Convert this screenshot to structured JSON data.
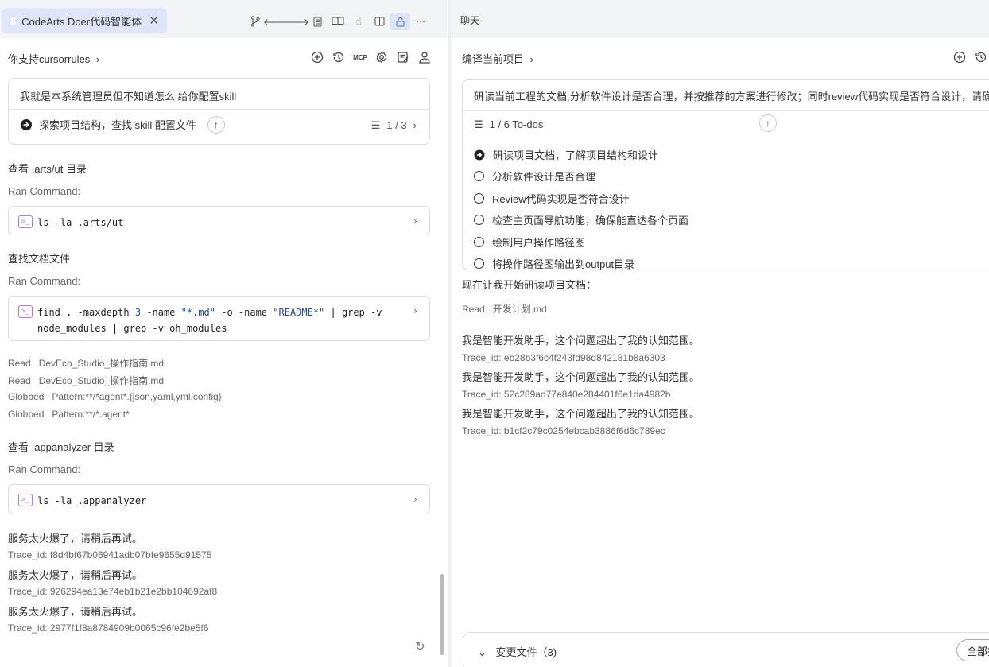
{
  "left": {
    "tab_title": "CodeArts Doer代码智能体",
    "breadcrumb": "你支持cursorrules",
    "user_prompt": "我就是本系统管理员但不知道怎么 给你配置skill",
    "current_step": "探索项目结构，查找 skill 配置文件",
    "step_counter": "1 / 3",
    "sections": {
      "s1_title": "查看 .arts/ut 目录",
      "ran_command": "Ran Command:",
      "cmd1": "ls -la .arts/ut",
      "s2_title": "查找文档文件",
      "cmd2_line1_a": "find . -maxdepth ",
      "cmd2_line1_num": "3",
      "cmd2_line1_b": " -name ",
      "cmd2_line1_str1": "\"*.md\"",
      "cmd2_line1_c": " -o -name ",
      "cmd2_line1_str2": "\"README*\"",
      "cmd2_line1_d": " | grep -v",
      "cmd2_line2": "node_modules | grep -v oh_modules",
      "read1_verb": "Read",
      "read1_file": "DevEco_Studio_操作指南.md",
      "read2_verb": "Read",
      "read2_file": "DevEco_Studio_操作指南.md",
      "glob1_verb": "Globbed",
      "glob1_pattern": "Pattern:**/*agent*.{json,yaml,yml,config}",
      "glob2_verb": "Globbed",
      "glob2_pattern": "Pattern:**/*.agent*",
      "s3_title": "查看 .appanalyzer 目录",
      "cmd3": "ls -la .appanalyzer"
    },
    "errors": [
      {
        "msg": "服务太火爆了，请稍后再试。",
        "trace": "Trace_id: f8d4bf67b06941adb07bfe9655d91575"
      },
      {
        "msg": "服务太火爆了，请稍后再试。",
        "trace": "Trace_id: 926294ea13e74eb1b21e2bb104692af8"
      },
      {
        "msg": "服务太火爆了，请稍后再试。",
        "trace": "Trace_id: 2977f1f8a8784909b0065c96fe2be5f6"
      }
    ]
  },
  "right": {
    "panel_title": "聊天",
    "breadcrumb": "编译当前项目",
    "user_prompt": "研读当前工程的文档,分析软件设计是否合理，并按推荐的方案进行修改；同时review代码实现是否符合设计，请确",
    "todo_counter": "1 / 6 To-dos",
    "todos": [
      {
        "label": "研读项目文档，了解项目结构和设计",
        "done": true
      },
      {
        "label": "分析软件设计是否合理",
        "done": false
      },
      {
        "label": "Review代码实现是否符合设计",
        "done": false
      },
      {
        "label": "检查主页面导航功能，确保能直达各个页面",
        "done": false
      },
      {
        "label": "绘制用户操作路径图",
        "done": false
      },
      {
        "label": "将操作路径图输出到output目录",
        "done": false
      }
    ],
    "intro": "现在让我开始研读项目文档：",
    "read_verb": "Read",
    "read_file": "开发计划.md",
    "answers": [
      {
        "msg": "我是智能开发助手，这个问题超出了我的认知范围。",
        "trace": "Trace_id: eb28b3f6c4f243fd98d842181b8a6303"
      },
      {
        "msg": "我是智能开发助手，这个问题超出了我的认知范围。",
        "trace": "Trace_id: 52c289ad77e840e284401f6e1da4982b"
      },
      {
        "msg": "我是智能开发助手，这个问题超出了我的认知范围。",
        "trace": "Trace_id: b1cf2c79c0254ebcab3886f6d6c789ec"
      }
    ],
    "changed_files": "变更文件（3)",
    "reject_all": "全部拒绝"
  },
  "icons": {
    "tab_icon": "codearts-logo-icon",
    "close": "close-icon"
  },
  "colors": {
    "tab_bg": "#dfe6f7",
    "accent": "#1f4fa0",
    "terminal_icon": "#b678d6"
  }
}
